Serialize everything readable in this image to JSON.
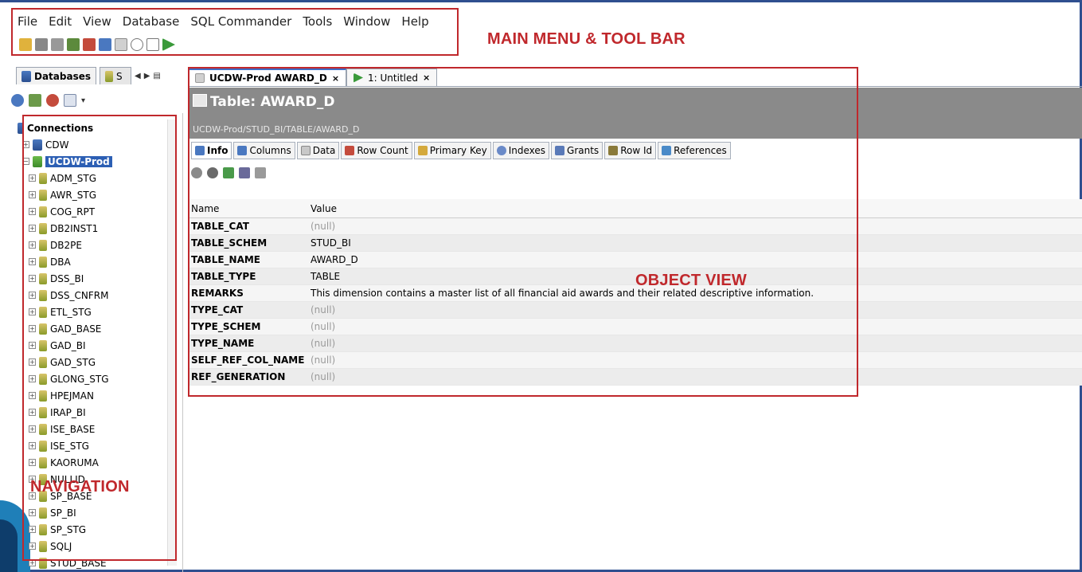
{
  "menu": [
    "File",
    "Edit",
    "View",
    "Database",
    "SQL Commander",
    "Tools",
    "Window",
    "Help"
  ],
  "annotations": {
    "menu_toolbar": "MAIN MENU & TOOL BAR",
    "navigation": "NAVIGATION",
    "object_view": "OBJECT VIEW"
  },
  "left_tabs": {
    "databases": "Databases",
    "second": "S"
  },
  "tree": {
    "root": "Connections",
    "connections": [
      "CDW",
      "UCDW-Prod"
    ],
    "schemas": [
      "ADM_STG",
      "AWR_STG",
      "COG_RPT",
      "DB2INST1",
      "DB2PE",
      "DBA",
      "DSS_BI",
      "DSS_CNFRM",
      "ETL_STG",
      "GAD_BASE",
      "GAD_BI",
      "GAD_STG",
      "GLONG_STG",
      "HPEJMAN",
      "IRAP_BI",
      "ISE_BASE",
      "ISE_STG",
      "KAORUMA",
      "NULLID",
      "SP_BASE",
      "SP_BI",
      "SP_STG",
      "SQLJ",
      "STUD_BASE"
    ]
  },
  "editor_tabs": [
    {
      "label": "UCDW-Prod AWARD_D",
      "close": "×"
    },
    {
      "label": "1: Untitled",
      "close": "×"
    }
  ],
  "object": {
    "title": "Table: AWARD_D",
    "path": "UCDW-Prod/STUD_BI/TABLE/AWARD_D"
  },
  "sub_tabs": [
    "Info",
    "Columns",
    "Data",
    "Row Count",
    "Primary Key",
    "Indexes",
    "Grants",
    "Row Id",
    "References"
  ],
  "grid": {
    "headers": [
      "Name",
      "Value"
    ],
    "rows": [
      [
        "TABLE_CAT",
        "(null)"
      ],
      [
        "TABLE_SCHEM",
        "STUD_BI"
      ],
      [
        "TABLE_NAME",
        "AWARD_D"
      ],
      [
        "TABLE_TYPE",
        "TABLE"
      ],
      [
        "REMARKS",
        "This dimension contains a master list of all financial aid awards and their related descriptive information."
      ],
      [
        "TYPE_CAT",
        "(null)"
      ],
      [
        "TYPE_SCHEM",
        "(null)"
      ],
      [
        "TYPE_NAME",
        "(null)"
      ],
      [
        "SELF_REF_COL_NAME",
        "(null)"
      ],
      [
        "REF_GENERATION",
        "(null)"
      ]
    ]
  },
  "colors": {
    "callout": "#c0282c",
    "banner": "#8a8a8a",
    "selection": "#2c5fb4",
    "frame": "#2f4f8f"
  }
}
